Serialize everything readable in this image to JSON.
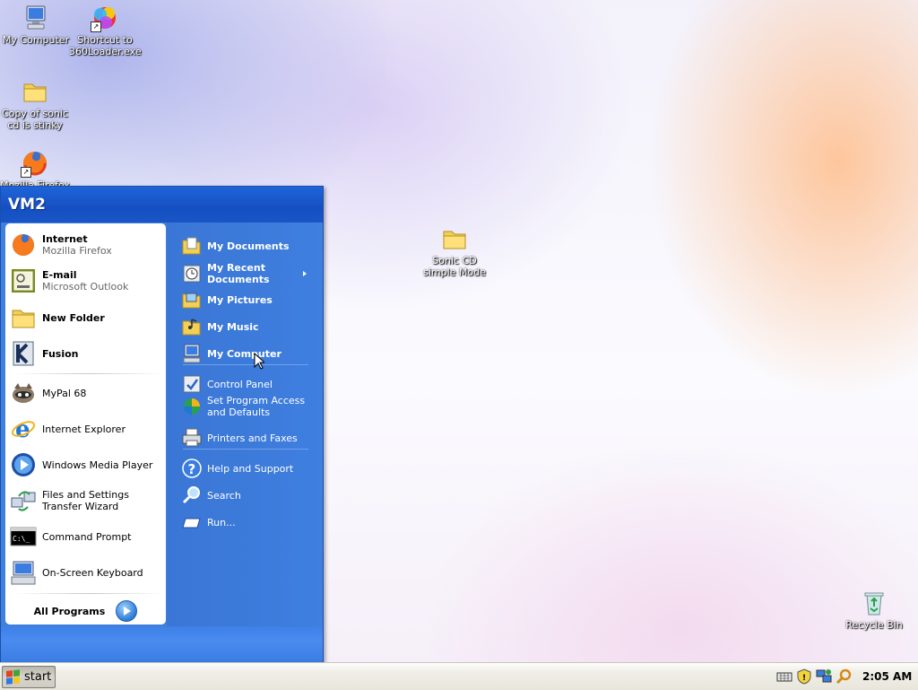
{
  "desktop": {
    "icons": [
      {
        "label": "My Computer"
      },
      {
        "label": "Shortcut to 360Loader.exe"
      },
      {
        "label": "Copy of sonic cd is stinky"
      },
      {
        "label": "Mozilla Firefox"
      },
      {
        "label": "Sonic CD simple Mode"
      },
      {
        "label": "Recycle Bin"
      }
    ]
  },
  "start_menu": {
    "user": "VM2",
    "pinned": [
      {
        "title": "Internet",
        "subtitle": "Mozilla Firefox"
      },
      {
        "title": "E-mail",
        "subtitle": "Microsoft Outlook"
      },
      {
        "title": "New Folder"
      },
      {
        "title": "Fusion"
      }
    ],
    "recent": [
      {
        "label": "MyPal 68"
      },
      {
        "label": "Internet Explorer"
      },
      {
        "label": "Windows Media Player"
      },
      {
        "label": "Files and Settings Transfer Wizard"
      },
      {
        "label": "Command Prompt"
      },
      {
        "label": "On-Screen Keyboard"
      }
    ],
    "all_programs": "All Programs",
    "places": [
      {
        "label": "My Documents"
      },
      {
        "label": "My Recent Documents"
      },
      {
        "label": "My Pictures"
      },
      {
        "label": "My Music"
      },
      {
        "label": "My Computer"
      }
    ],
    "settings": [
      {
        "label": "Control Panel"
      },
      {
        "label": "Set Program Access and Defaults"
      },
      {
        "label": "Printers and Faxes"
      }
    ],
    "tools": [
      {
        "label": "Help and Support"
      },
      {
        "label": "Search"
      },
      {
        "label": "Run..."
      }
    ]
  },
  "taskbar": {
    "start_label": "start",
    "clock": "2:05 AM"
  },
  "colors": {
    "menu_blue": "#3f80dd",
    "header_blue": "#1f64d9"
  }
}
